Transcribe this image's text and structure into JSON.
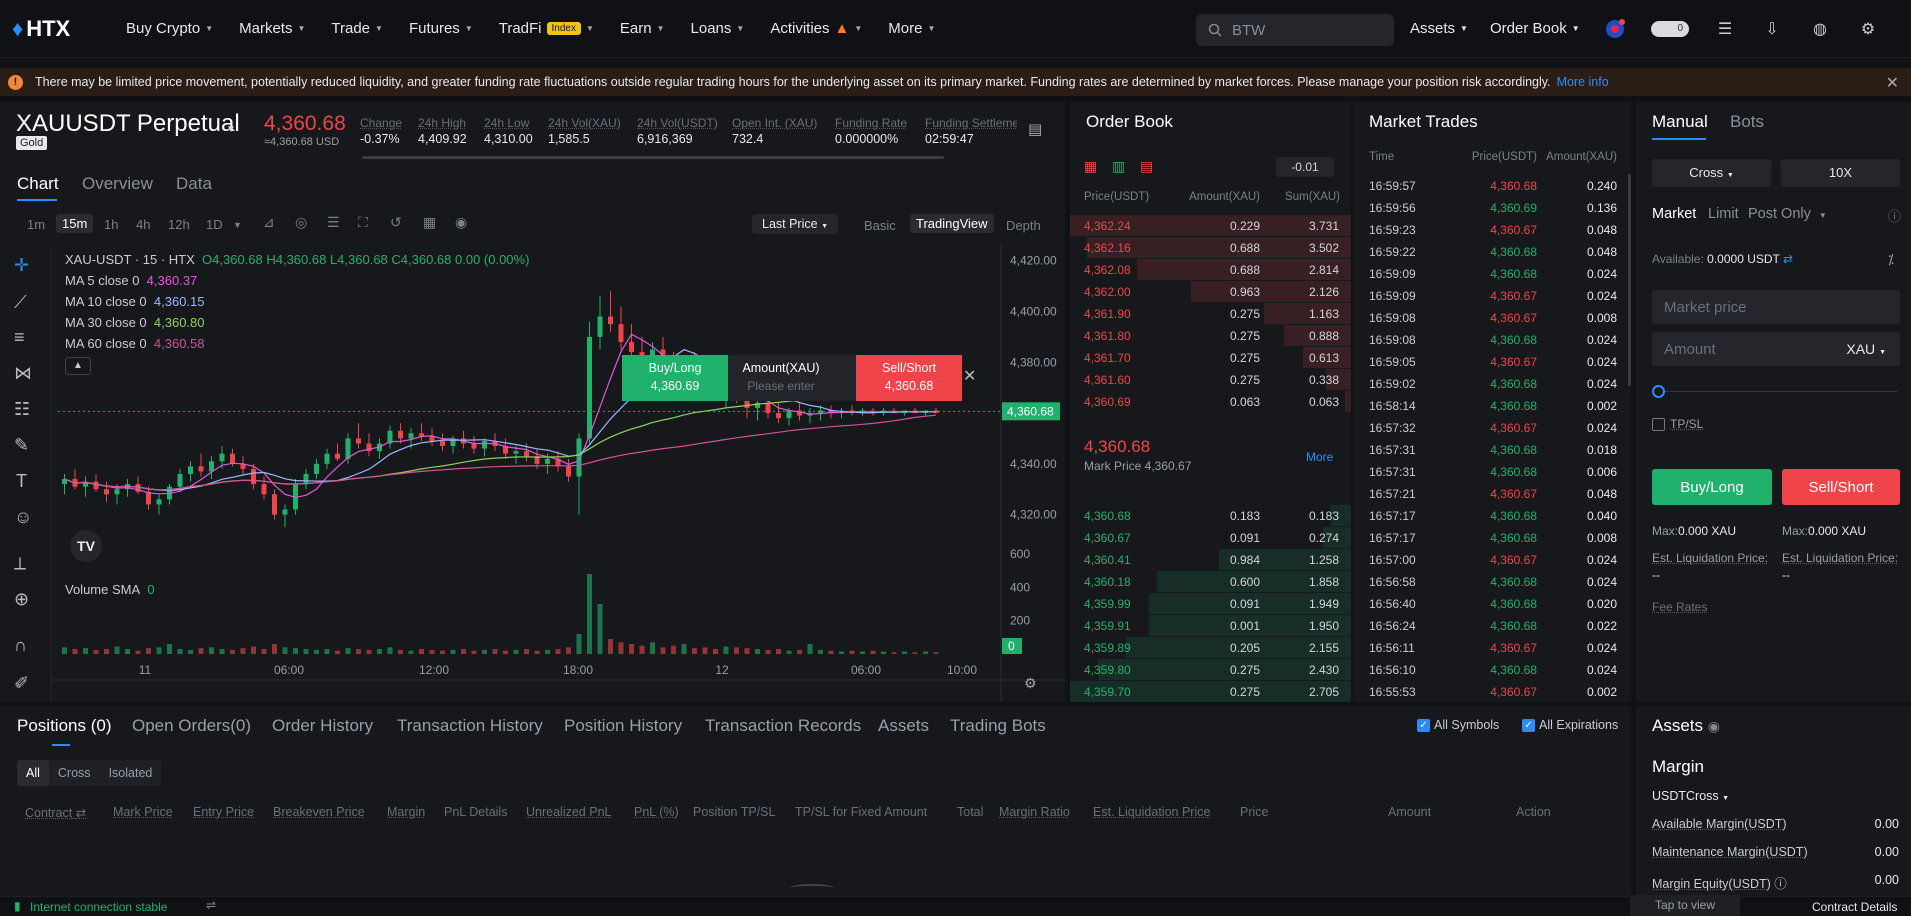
{
  "nav": {
    "logo": "HTX",
    "items": [
      "Buy Crypto",
      "Markets",
      "Trade",
      "Futures",
      "TradFi",
      "Earn",
      "Loans",
      "Activities",
      "More"
    ],
    "tradfi_badge": "Index",
    "search_placeholder": "BTW",
    "assets": "Assets",
    "order_book": "Order Book",
    "toggle_value": "0"
  },
  "banner": {
    "text": "There may be limited price movement, potentially reduced liquidity, and greater funding rate fluctuations outside regular trading hours for the underlying asset on its primary market. Funding rates are determined by market forces. Please manage your position risk accordingly.",
    "link": "More info"
  },
  "ticker": {
    "symbol": "XAUUSDT Perpetual",
    "tag": "Gold",
    "price": "4,360.68",
    "price_sub": "≈4,360.68 USD",
    "stats": [
      {
        "label": "Change",
        "value": "-0.37%",
        "color": "#ef454a"
      },
      {
        "label": "24h High",
        "value": "4,409.92"
      },
      {
        "label": "24h Low",
        "value": "4,310.00"
      },
      {
        "label": "24h Vol(XAU)",
        "value": "1,585.5"
      },
      {
        "label": "24h Vol(USDT)",
        "value": "6,916,369"
      },
      {
        "label": "Open Int. (XAU)",
        "value": "732.4"
      },
      {
        "label": "Funding Rate",
        "value": "0.000000%"
      },
      {
        "label": "Funding Settleme",
        "value": "02:59:47"
      }
    ]
  },
  "chart_tabs": [
    "Chart",
    "Overview",
    "Data"
  ],
  "timeframes": [
    "1m",
    "15m",
    "1h",
    "4h",
    "12h",
    "1D"
  ],
  "chart_toolbar": {
    "price_mode": "Last Price",
    "modes": [
      "Basic",
      "TradingView",
      "Depth"
    ]
  },
  "chart_legend": {
    "header": "XAU-USDT · 15 · HTX",
    "ohlc": "O4,360.68 H4,360.68 L4,360.68 C4,360.68 0.00 (0.00%)",
    "mas": [
      {
        "label": "MA 5 close 0",
        "value": "4,360.37",
        "color": "#e05ad8"
      },
      {
        "label": "MA 10 close 0",
        "value": "4,360.15",
        "color": "#9cb7ff"
      },
      {
        "label": "MA 30 close 0",
        "value": "4,360.80",
        "color": "#8bd35a"
      },
      {
        "label": "MA 60 close 0",
        "value": "4,360.58",
        "color": "#d4509a"
      }
    ],
    "volume_label": "Volume SMA",
    "volume_value": "0"
  },
  "quick_order": {
    "buy": "Buy/Long",
    "buy_price": "4,360.69",
    "amount": "Amount(XAU)",
    "amount_placeholder": "Please enter",
    "sell": "Sell/Short",
    "sell_price": "4,360.68"
  },
  "chart_data": {
    "type": "candlestick",
    "y_ticks": [
      "4,420.00",
      "4,400.00",
      "4,380.00",
      "4,360.00",
      "4,340.00",
      "4,320.00"
    ],
    "ylim": [
      4310,
      4425
    ],
    "current_price": "4,360.68",
    "x_ticks": [
      "11",
      "06:00",
      "12:00",
      "18:00",
      "12",
      "06:00",
      "10:00"
    ],
    "volume_ticks": [
      "600",
      "400",
      "200",
      "0"
    ],
    "candles": [
      [
        4332,
        4336,
        4328,
        4334
      ],
      [
        4334,
        4338,
        4330,
        4331
      ],
      [
        4331,
        4335,
        4327,
        4333
      ],
      [
        4333,
        4336,
        4329,
        4330
      ],
      [
        4330,
        4333,
        4325,
        4328
      ],
      [
        4328,
        4332,
        4324,
        4330
      ],
      [
        4330,
        4334,
        4327,
        4332
      ],
      [
        4332,
        4335,
        4328,
        4329
      ],
      [
        4329,
        4331,
        4322,
        4324
      ],
      [
        4324,
        4328,
        4320,
        4326
      ],
      [
        4326,
        4332,
        4324,
        4331
      ],
      [
        4331,
        4338,
        4329,
        4336
      ],
      [
        4336,
        4341,
        4333,
        4339
      ],
      [
        4339,
        4344,
        4335,
        4337
      ],
      [
        4337,
        4343,
        4334,
        4341
      ],
      [
        4341,
        4347,
        4338,
        4344
      ],
      [
        4344,
        4346,
        4339,
        4340
      ],
      [
        4340,
        4343,
        4336,
        4338
      ],
      [
        4338,
        4340,
        4330,
        4332
      ],
      [
        4332,
        4335,
        4326,
        4328
      ],
      [
        4328,
        4330,
        4318,
        4320
      ],
      [
        4320,
        4324,
        4315,
        4322
      ],
      [
        4322,
        4334,
        4320,
        4332
      ],
      [
        4332,
        4338,
        4330,
        4336
      ],
      [
        4336,
        4342,
        4334,
        4340
      ],
      [
        4340,
        4346,
        4338,
        4344
      ],
      [
        4344,
        4348,
        4341,
        4342
      ],
      [
        4342,
        4352,
        4340,
        4350
      ],
      [
        4350,
        4356,
        4346,
        4348
      ],
      [
        4348,
        4352,
        4343,
        4345
      ],
      [
        4345,
        4350,
        4342,
        4348
      ],
      [
        4348,
        4355,
        4346,
        4353
      ],
      [
        4353,
        4356,
        4348,
        4350
      ],
      [
        4350,
        4354,
        4346,
        4352
      ],
      [
        4352,
        4356,
        4349,
        4351
      ],
      [
        4351,
        4354,
        4347,
        4349
      ],
      [
        4349,
        4352,
        4345,
        4347
      ],
      [
        4347,
        4351,
        4344,
        4350
      ],
      [
        4350,
        4353,
        4346,
        4348
      ],
      [
        4348,
        4351,
        4344,
        4346
      ],
      [
        4346,
        4350,
        4343,
        4349
      ],
      [
        4349,
        4352,
        4345,
        4347
      ],
      [
        4347,
        4350,
        4342,
        4344
      ],
      [
        4344,
        4347,
        4340,
        4345
      ],
      [
        4345,
        4348,
        4341,
        4343
      ],
      [
        4343,
        4346,
        4338,
        4340
      ],
      [
        4340,
        4344,
        4336,
        4342
      ],
      [
        4342,
        4345,
        4337,
        4339
      ],
      [
        4339,
        4342,
        4333,
        4335
      ],
      [
        4335,
        4352,
        4320,
        4350
      ],
      [
        4350,
        4396,
        4348,
        4390
      ],
      [
        4390,
        4406,
        4385,
        4398
      ],
      [
        4398,
        4408,
        4392,
        4395
      ],
      [
        4395,
        4402,
        4385,
        4388
      ],
      [
        4388,
        4395,
        4380,
        4384
      ],
      [
        4384,
        4390,
        4376,
        4379
      ],
      [
        4379,
        4388,
        4374,
        4385
      ],
      [
        4385,
        4390,
        4376,
        4378
      ],
      [
        4378,
        4384,
        4370,
        4374
      ],
      [
        4374,
        4381,
        4368,
        4379
      ],
      [
        4379,
        4384,
        4372,
        4375
      ],
      [
        4375,
        4380,
        4368,
        4371
      ],
      [
        4371,
        4376,
        4365,
        4368
      ],
      [
        4368,
        4374,
        4362,
        4372
      ],
      [
        4372,
        4376,
        4364,
        4366
      ],
      [
        4366,
        4370,
        4358,
        4362
      ],
      [
        4362,
        4367,
        4357,
        4364
      ],
      [
        4364,
        4368,
        4358,
        4360
      ],
      [
        4360,
        4364,
        4356,
        4358
      ],
      [
        4358,
        4362,
        4355,
        4361
      ],
      [
        4361,
        4364,
        4357,
        4359
      ],
      [
        4359,
        4362,
        4356,
        4360
      ],
      [
        4360,
        4363,
        4357,
        4361
      ],
      [
        4361,
        4363,
        4358,
        4360
      ],
      [
        4360,
        4362,
        4358,
        4361
      ],
      [
        4361,
        4363,
        4359,
        4360
      ],
      [
        4360,
        4362,
        4359,
        4361
      ],
      [
        4361,
        4362,
        4359,
        4360
      ],
      [
        4360,
        4362,
        4359,
        4361
      ],
      [
        4361,
        4362,
        4360,
        4360
      ],
      [
        4360,
        4361,
        4359,
        4361
      ],
      [
        4361,
        4362,
        4360,
        4360
      ],
      [
        4360,
        4361,
        4359,
        4361
      ],
      [
        4361,
        4362,
        4360,
        4360
      ]
    ],
    "volumes": [
      40,
      30,
      35,
      25,
      30,
      45,
      30,
      20,
      35,
      40,
      60,
      30,
      25,
      35,
      40,
      30,
      25,
      35,
      45,
      30,
      60,
      40,
      35,
      30,
      25,
      30,
      20,
      35,
      30,
      25,
      30,
      40,
      25,
      20,
      30,
      25,
      20,
      25,
      30,
      20,
      25,
      30,
      20,
      25,
      30,
      20,
      25,
      30,
      40,
      120,
      480,
      300,
      90,
      70,
      60,
      50,
      70,
      40,
      50,
      60,
      35,
      40,
      30,
      45,
      40,
      35,
      30,
      25,
      30,
      20,
      25,
      60,
      25,
      20,
      15,
      20,
      15,
      20,
      15,
      10,
      15,
      10,
      15,
      10
    ]
  },
  "order_book": {
    "title": "Order Book",
    "tick": "-0.01",
    "headers": [
      "Price(USDT)",
      "Amount(XAU)",
      "Sum(XAU)"
    ],
    "asks": [
      [
        "4,362.24",
        "0.229",
        "3.731",
        1.0
      ],
      [
        "4,362.16",
        "0.688",
        "3.502",
        0.94
      ],
      [
        "4,362.08",
        "0.688",
        "2.814",
        0.76
      ],
      [
        "4,362.00",
        "0.963",
        "2.126",
        0.57
      ],
      [
        "4,361.90",
        "0.275",
        "1.163",
        0.31
      ],
      [
        "4,361.80",
        "0.275",
        "0.888",
        0.24
      ],
      [
        "4,361.70",
        "0.275",
        "0.613",
        0.17
      ],
      [
        "4,361.60",
        "0.275",
        "0.338",
        0.09
      ],
      [
        "4,360.69",
        "0.063",
        "0.063",
        0.02
      ]
    ],
    "mid_price": "4,360.68",
    "mark_price": "Mark Price 4,360.67",
    "more": "More",
    "bids": [
      [
        "4,360.68",
        "0.183",
        "0.183",
        0.07
      ],
      [
        "4,360.67",
        "0.091",
        "0.274",
        0.1
      ],
      [
        "4,360.41",
        "0.984",
        "1.258",
        0.47
      ],
      [
        "4,360.18",
        "0.600",
        "1.858",
        0.69
      ],
      [
        "4,359.99",
        "0.091",
        "1.949",
        0.72
      ],
      [
        "4,359.91",
        "0.001",
        "1.950",
        0.72
      ],
      [
        "4,359.89",
        "0.205",
        "2.155",
        0.8
      ],
      [
        "4,359.80",
        "0.275",
        "2.430",
        0.9
      ],
      [
        "4,359.70",
        "0.275",
        "2.705",
        1.0
      ]
    ]
  },
  "market_trades": {
    "title": "Market Trades",
    "headers": [
      "Time",
      "Price(USDT)",
      "Amount(XAU)"
    ],
    "rows": [
      [
        "16:59:57",
        "4,360.68",
        "0.240",
        "down"
      ],
      [
        "16:59:56",
        "4,360.69",
        "0.136",
        "up"
      ],
      [
        "16:59:23",
        "4,360.67",
        "0.048",
        "down"
      ],
      [
        "16:59:22",
        "4,360.68",
        "0.048",
        "up"
      ],
      [
        "16:59:09",
        "4,360.68",
        "0.024",
        "up"
      ],
      [
        "16:59:09",
        "4,360.67",
        "0.024",
        "down"
      ],
      [
        "16:59:08",
        "4,360.67",
        "0.008",
        "down"
      ],
      [
        "16:59:08",
        "4,360.68",
        "0.024",
        "up"
      ],
      [
        "16:59:05",
        "4,360.67",
        "0.024",
        "down"
      ],
      [
        "16:59:02",
        "4,360.68",
        "0.024",
        "up"
      ],
      [
        "16:58:14",
        "4,360.68",
        "0.002",
        "up"
      ],
      [
        "16:57:32",
        "4,360.67",
        "0.024",
        "down"
      ],
      [
        "16:57:31",
        "4,360.68",
        "0.018",
        "up"
      ],
      [
        "16:57:31",
        "4,360.68",
        "0.006",
        "up"
      ],
      [
        "16:57:21",
        "4,360.67",
        "0.048",
        "down"
      ],
      [
        "16:57:17",
        "4,360.68",
        "0.040",
        "up"
      ],
      [
        "16:57:17",
        "4,360.68",
        "0.008",
        "up"
      ],
      [
        "16:57:00",
        "4,360.67",
        "0.024",
        "down"
      ],
      [
        "16:56:58",
        "4,360.68",
        "0.024",
        "up"
      ],
      [
        "16:56:40",
        "4,360.68",
        "0.020",
        "up"
      ],
      [
        "16:56:24",
        "4,360.68",
        "0.022",
        "up"
      ],
      [
        "16:56:11",
        "4,360.67",
        "0.024",
        "down"
      ],
      [
        "16:56:10",
        "4,360.68",
        "0.024",
        "up"
      ],
      [
        "16:55:53",
        "4,360.67",
        "0.002",
        "down"
      ]
    ]
  },
  "trade": {
    "tabs": [
      "Manual",
      "Bots"
    ],
    "margin_mode": "Cross",
    "leverage": "10X",
    "order_types": [
      "Market",
      "Limit",
      "Post Only"
    ],
    "available_label": "Available:",
    "available_value": "0.0000 USDT",
    "price_placeholder": "Market price",
    "amount_placeholder": "Amount",
    "amount_unit": "XAU",
    "tpsl": "TP/SL",
    "buy": "Buy/Long",
    "sell": "Sell/Short",
    "max_label": "Max:",
    "max_value": "0.000 XAU",
    "liq_label": "Est. Liquidation Price:",
    "liq_value": "--",
    "fee_rates": "Fee Rates"
  },
  "positions": {
    "tabs": [
      "Positions (0)",
      "Open Orders(0)",
      "Order History",
      "Transaction History",
      "Position History",
      "Transaction Records",
      "Assets",
      "Trading Bots"
    ],
    "filters": [
      "All",
      "Cross",
      "Isolated"
    ],
    "checks": [
      "All Symbols",
      "All Expirations"
    ],
    "columns": [
      "Contract",
      "Mark Price",
      "Entry Price",
      "Breakeven Price",
      "Margin",
      "PnL Details",
      "Unrealized PnL",
      "PnL (%)",
      "Position TP/SL",
      "TP/SL for Fixed Amount",
      "Total",
      "Margin Ratio",
      "Est. Liquidation Price",
      "Price",
      "Amount",
      "Action"
    ]
  },
  "assets": {
    "title": "Assets",
    "margin_title": "Margin",
    "margin_mode": "USDTCross",
    "rows": [
      {
        "label": "Available Margin(USDT)",
        "value": "0.00"
      },
      {
        "label": "Maintenance Margin(USDT)",
        "value": "0.00"
      },
      {
        "label": "Margin Equity(USDT)",
        "value": "0.00"
      }
    ],
    "tap": "Tap to view"
  },
  "status": {
    "connection": "Internet connection stable",
    "contract_details": "Contract Details"
  }
}
